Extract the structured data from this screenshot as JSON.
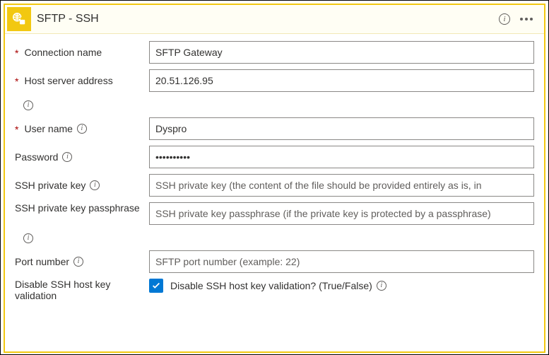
{
  "header": {
    "title": "SFTP - SSH"
  },
  "fields": {
    "connection_name": {
      "label": "Connection name",
      "value": "SFTP Gateway"
    },
    "host": {
      "label": "Host server address",
      "value": "20.51.126.95"
    },
    "user": {
      "label": "User name",
      "value": "Dyspro"
    },
    "password": {
      "label": "Password",
      "value": "••••••••••"
    },
    "ssh_key": {
      "label": "SSH private key",
      "placeholder": "SSH private key (the content of the file should be provided entirely as is, in"
    },
    "ssh_passphrase": {
      "label": "SSH private key passphrase",
      "placeholder": "SSH private key passphrase (if the private key is protected by a passphrase)"
    },
    "port": {
      "label": "Port number",
      "placeholder": "SFTP port number (example: 22)"
    },
    "disable_validation": {
      "label": "Disable SSH host key validation",
      "checkbox_label": "Disable SSH host key validation? (True/False)"
    }
  }
}
